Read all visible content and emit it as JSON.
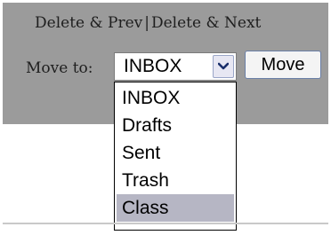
{
  "actions": {
    "delete_prev": "Delete & Prev",
    "separator": "|",
    "delete_next": "Delete & Next"
  },
  "move": {
    "label": "Move to:",
    "selected_value": "INBOX",
    "button_label": "Move",
    "dropdown_open": true,
    "options": [
      "INBOX",
      "Drafts",
      "Sent",
      "Trash",
      "Class"
    ],
    "highlighted_option": "Class"
  },
  "colors": {
    "panel_background": "#9b9b9b",
    "highlight": "#b6b6c4",
    "arrow_button": "#e7e7f3"
  },
  "icons": {
    "dropdown_arrow": "chevron-down-icon"
  }
}
